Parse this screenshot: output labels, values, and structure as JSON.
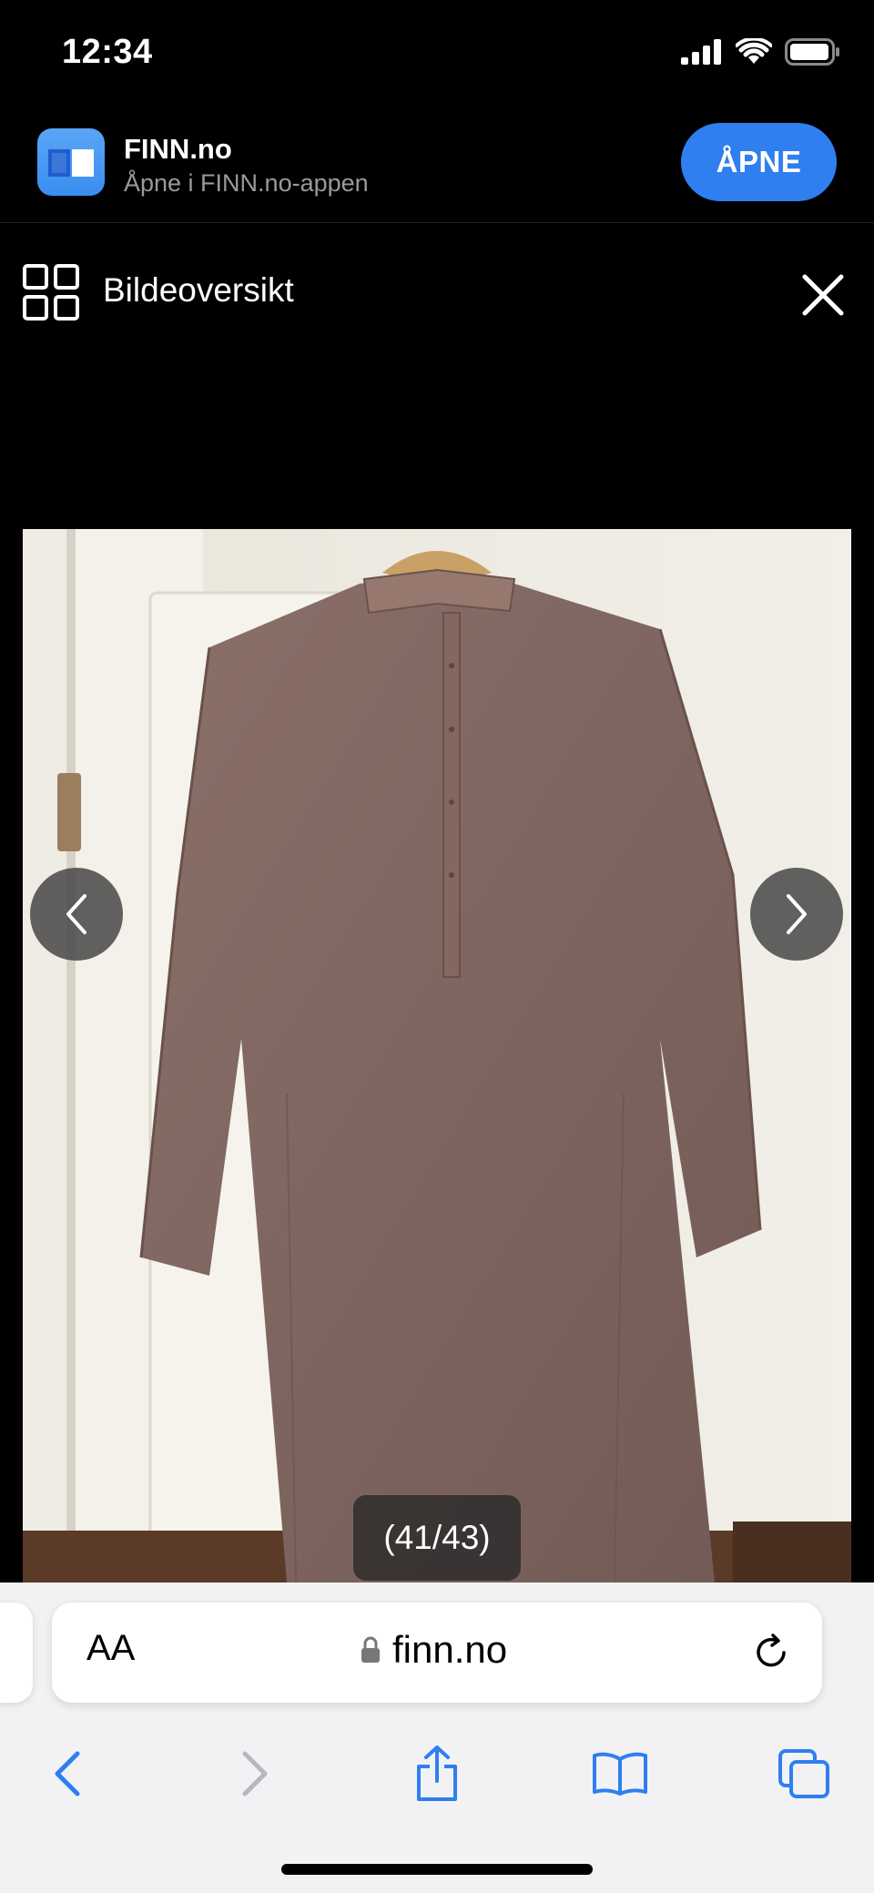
{
  "status_bar": {
    "time": "12:34"
  },
  "app_banner": {
    "title": "FINN.no",
    "subtitle": "Åpne i FINN.no-appen",
    "open_label": "ÅPNE",
    "accent": "#2f7ff0"
  },
  "gallery": {
    "overview_label": "Bildeoversikt",
    "counter": "(41/43)",
    "icons": [
      "grid-icon",
      "close-icon",
      "chevron-left-icon",
      "chevron-right-icon"
    ]
  },
  "browser": {
    "text_size_label": "AA",
    "url": "finn.no",
    "tint": "#2f7ff0",
    "icons": [
      "lock-icon",
      "reload-icon",
      "back-icon",
      "forward-icon",
      "share-icon",
      "bookmarks-icon",
      "tabs-icon"
    ]
  }
}
